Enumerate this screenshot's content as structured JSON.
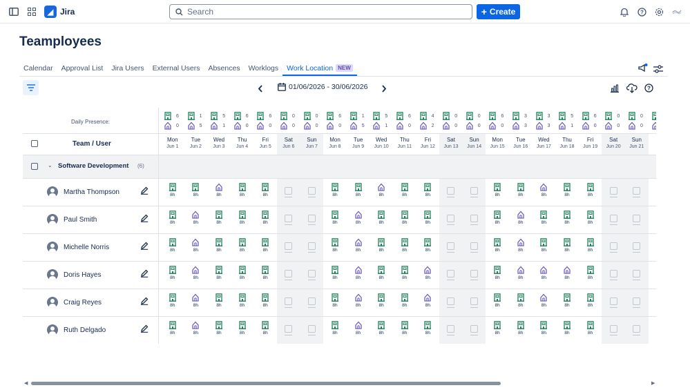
{
  "app": {
    "name": "Jira"
  },
  "search": {
    "placeholder": "Search"
  },
  "create_label": "Create",
  "page_title": "Teamployees",
  "tabs": [
    {
      "label": "Calendar"
    },
    {
      "label": "Approval List"
    },
    {
      "label": "Jira Users"
    },
    {
      "label": "External Users"
    },
    {
      "label": "Absences"
    },
    {
      "label": "Worklogs"
    },
    {
      "label": "Work Location",
      "badge": "NEW",
      "active": true
    }
  ],
  "date_range": "01/06/2026 - 30/06/2026",
  "presence_label": "Daily Presence:",
  "header": {
    "team_user": "Team / User"
  },
  "group": {
    "name": "Software Development",
    "count": "(6)"
  },
  "colors": {
    "office": "#1f845a",
    "home": "#6e5dc6",
    "accent": "#0c66e4"
  },
  "days": [
    {
      "dow": "Mon",
      "date": "Jun 1",
      "office": "6",
      "home": "0",
      "weekend": false
    },
    {
      "dow": "Tue",
      "date": "Jun 2",
      "office": "1",
      "home": "5",
      "weekend": false
    },
    {
      "dow": "Wed",
      "date": "Jun 3",
      "office": "5",
      "home": "1",
      "weekend": false
    },
    {
      "dow": "Thu",
      "date": "Jun 4",
      "office": "6",
      "home": "0",
      "weekend": false
    },
    {
      "dow": "Fri",
      "date": "Jun 5",
      "office": "6",
      "home": "0",
      "weekend": false
    },
    {
      "dow": "Sat",
      "date": "Jun 6",
      "office": "0",
      "home": "0",
      "weekend": true
    },
    {
      "dow": "Sun",
      "date": "Jun 7",
      "office": "0",
      "home": "0",
      "weekend": true
    },
    {
      "dow": "Mon",
      "date": "Jun 8",
      "office": "6",
      "home": "0",
      "weekend": false
    },
    {
      "dow": "Tue",
      "date": "Jun 9",
      "office": "1",
      "home": "5",
      "weekend": false
    },
    {
      "dow": "Wed",
      "date": "Jun 10",
      "office": "5",
      "home": "1",
      "weekend": false
    },
    {
      "dow": "Thu",
      "date": "Jun 11",
      "office": "6",
      "home": "0",
      "weekend": false
    },
    {
      "dow": "Fri",
      "date": "Jun 12",
      "office": "4",
      "home": "2",
      "weekend": false
    },
    {
      "dow": "Sat",
      "date": "Jun 13",
      "office": "0",
      "home": "0",
      "weekend": true
    },
    {
      "dow": "Sun",
      "date": "Jun 14",
      "office": "0",
      "home": "0",
      "weekend": true
    },
    {
      "dow": "Mon",
      "date": "Jun 15",
      "office": "6",
      "home": "0",
      "weekend": false
    },
    {
      "dow": "Tue",
      "date": "Jun 16",
      "office": "3",
      "home": "3",
      "weekend": false
    },
    {
      "dow": "Wed",
      "date": "Jun 17",
      "office": "3",
      "home": "3",
      "weekend": false
    },
    {
      "dow": "Thu",
      "date": "Jun 18",
      "office": "5",
      "home": "1",
      "weekend": false
    },
    {
      "dow": "Fri",
      "date": "Jun 19",
      "office": "6",
      "home": "0",
      "weekend": false
    },
    {
      "dow": "Sat",
      "date": "Jun 20",
      "office": "0",
      "home": "0",
      "weekend": true
    },
    {
      "dow": "Sun",
      "date": "Jun 21",
      "office": "0",
      "home": "0",
      "weekend": true
    },
    {
      "dow": "M",
      "date": "Ju",
      "office": "",
      "home": "",
      "weekend": false
    }
  ],
  "hours_label": "8h",
  "users": [
    {
      "name": "Martha Thompson",
      "locs": "OOHOOwwOOHOOwwOOHOOwwO"
    },
    {
      "name": "Paul Smith",
      "locs": "OHOOOwwOHOOOwwOHOOOwwO"
    },
    {
      "name": "Michelle Norris",
      "locs": "OHOOOwwOHOOOwwOHOOOwwO"
    },
    {
      "name": "Doris Hayes",
      "locs": "OHOOOwwOHOOHwwOHHHOwwO"
    },
    {
      "name": "Craig Reyes",
      "locs": "OHOOOwwOHOOHwwOOHOOwwO"
    },
    {
      "name": "Ruth Delgado",
      "locs": "OHOOOwwOHOOOwwOOOOOwwO"
    }
  ]
}
